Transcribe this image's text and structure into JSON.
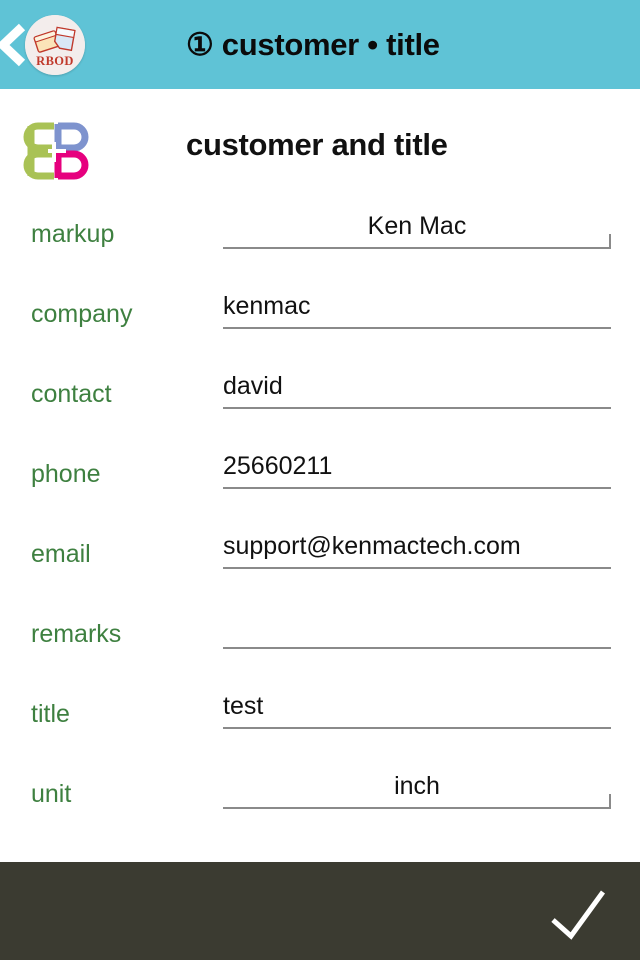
{
  "header": {
    "back_icon": "chevron-left-icon",
    "brand_badge_text": "RBOD",
    "brand_badge_icon": "rbod-books-logo",
    "title": "① customer • title",
    "background_color": "#5FC3D6"
  },
  "page": {
    "logo_icon": "bb-mirrored-logo",
    "logo_colors": {
      "left": "#A9C255",
      "top_right": "#7E93CE",
      "bottom_right": "#E6007E"
    },
    "title": "customer and title",
    "label_color": "#3E8040"
  },
  "form": {
    "rows": [
      {
        "label": "markup",
        "value": "Ken Mac",
        "align": "center",
        "picker": true
      },
      {
        "label": "company",
        "value": "kenmac",
        "align": "left",
        "picker": false
      },
      {
        "label": "contact",
        "value": "david",
        "align": "left",
        "picker": false
      },
      {
        "label": "phone",
        "value": "25660211",
        "align": "left",
        "picker": false
      },
      {
        "label": "email",
        "value": "support@kenmactech.com",
        "align": "left",
        "picker": false
      },
      {
        "label": "remarks",
        "value": "",
        "align": "left",
        "picker": false
      },
      {
        "label": "title",
        "value": "test",
        "align": "left",
        "picker": false
      },
      {
        "label": "unit",
        "value": "inch",
        "align": "center",
        "picker": true
      }
    ]
  },
  "bottom_bar": {
    "confirm_icon": "checkmark-icon",
    "background_color": "#3B3B31"
  }
}
